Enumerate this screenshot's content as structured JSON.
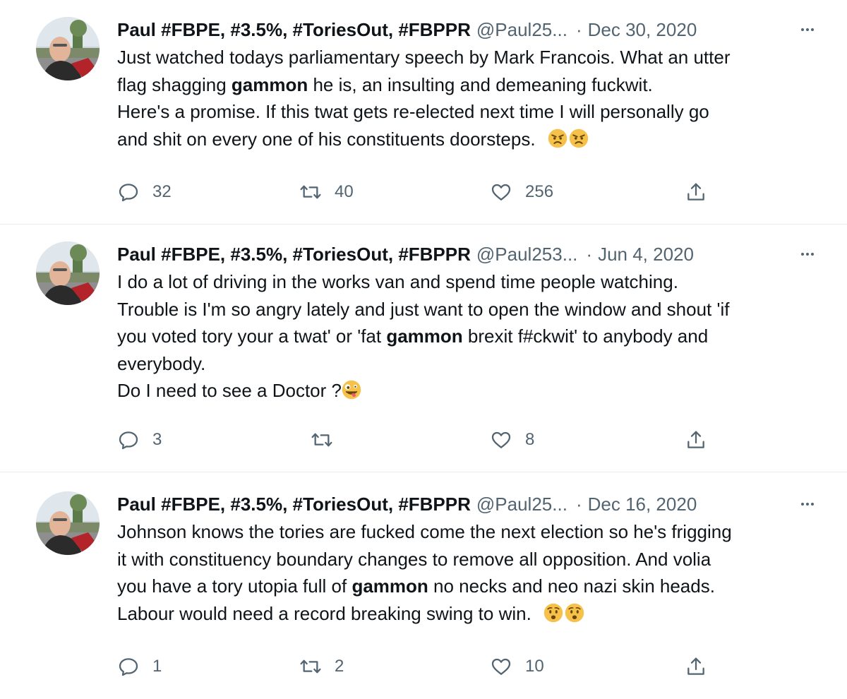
{
  "tweets": [
    {
      "name": "Paul #FBPE, #3.5%, #ToriesOut, #FBPPR",
      "handle": "@Paul25...",
      "date": "Dec 30, 2020",
      "lines": [
        [
          "Just watched todays parliamentary speech by Mark Francois. What an utter"
        ],
        [
          "flag shagging ",
          "gammon",
          " he is, an insulting and demeaning fuckwit."
        ],
        [
          "Here's a promise. If this twat gets re-elected next time I will personally go"
        ],
        [
          "and shit on every one of his constituents doorsteps."
        ]
      ],
      "emojis": [
        "angry-face",
        "angry-face"
      ],
      "replies": "32",
      "retweets": "40",
      "likes": "256"
    },
    {
      "name": "Paul #FBPE, #3.5%, #ToriesOut, #FBPPR",
      "handle": "@Paul253...",
      "date": "Jun 4, 2020",
      "lines": [
        [
          "I do a lot of driving in the works van and spend time people watching."
        ],
        [
          "Trouble is I'm so angry lately and just want to open the window and shout 'if"
        ],
        [
          "you voted tory your a twat' or 'fat ",
          "gammon",
          " brexit f#ckwit' to anybody and"
        ],
        [
          "everybody."
        ],
        [
          "Do I need to see a Doctor ?"
        ]
      ],
      "emojis": [
        "zany-face"
      ],
      "replies": "3",
      "retweets": "",
      "likes": "8"
    },
    {
      "name": "Paul #FBPE, #3.5%, #ToriesOut, #FBPPR",
      "handle": "@Paul25...",
      "date": "Dec 16, 2020",
      "lines": [
        [
          "Johnson knows the tories are fucked come the next election so he's frigging"
        ],
        [
          "it with constituency boundary changes to remove all opposition. And volia"
        ],
        [
          "you have a tory utopia full of ",
          "gammon",
          " no necks and neo nazi skin heads."
        ],
        [
          "Labour would need a record breaking swing to win."
        ]
      ],
      "emojis": [
        "hushed-worried-face",
        "hushed-worried-face"
      ],
      "replies": "1",
      "retweets": "2",
      "likes": "10"
    }
  ],
  "colors": {
    "text": "#0f1419",
    "secondary": "#536471",
    "divider": "#e6ecf0"
  }
}
